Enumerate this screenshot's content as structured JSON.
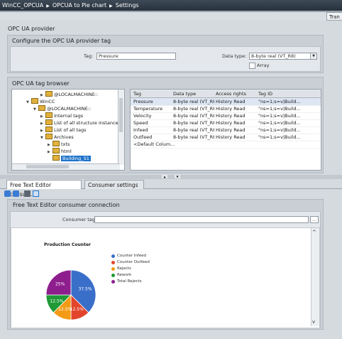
{
  "title_bar": {
    "crumbs": [
      "WinCC_OPCUA",
      "OPCUA to Pie chart",
      "Settings"
    ],
    "separator": "▶"
  },
  "top_tab": {
    "label": "Tran"
  },
  "opc_provider": {
    "section_title": "OPC UA provider",
    "panel_title": "Configure the OPC UA provider tag",
    "tag_label": "Tag:",
    "tag_value": "Pressure",
    "data_type_label": "Data type:",
    "data_type_value": "8-byte real (VT_R8)",
    "array_label": "Array"
  },
  "tag_browser": {
    "title": "OPC UA tag browser",
    "tree": [
      {
        "label": "@LOCALMACHINE::",
        "arrow": "▶"
      },
      {
        "label": "WinCC",
        "arrow": "▼"
      },
      {
        "label": "@LOCALMACHINE::",
        "arrow": "▼"
      },
      {
        "label": "Internal tags",
        "arrow": "▶"
      },
      {
        "label": "List of all structure instances",
        "arrow": "▶"
      },
      {
        "label": "List of all tags",
        "arrow": "▶"
      },
      {
        "label": "Archives",
        "arrow": "▼"
      },
      {
        "label": "txts",
        "arrow": "▶"
      },
      {
        "label": "html",
        "arrow": "▶"
      },
      {
        "label": "Building_S1",
        "arrow": ""
      }
    ],
    "columns": [
      "Tag",
      "Data type",
      "Access rights",
      "Tag ID"
    ],
    "rows": [
      [
        "Pressure",
        "8-byte real (VT_R8",
        "History Read",
        "\"ns=1;s=v|Build..."
      ],
      [
        "Temperature",
        "8-byte real (VT_R8",
        "History Read",
        "\"ns=1;s=v|Build..."
      ],
      [
        "Velocity",
        "8-byte real (VT_R8",
        "History Read",
        "\"ns=1;s=v|Build..."
      ],
      [
        "Speed",
        "8-byte real (VT_R8",
        "History Read",
        "\"ns=1;s=v|Build..."
      ],
      [
        "Infeed",
        "8-byte real (VT_R8",
        "History Read",
        "\"ns=1;s=v|Build..."
      ],
      [
        "Outfeed",
        "8-byte real (VT_R8",
        "History Read",
        "\"ns=1;s=v|Build..."
      ],
      [
        "<Default Colum...",
        "",
        "",
        ""
      ]
    ]
  },
  "bottom_tabs": [
    "Free Text Editor consum...",
    "Consumer settings"
  ],
  "consumer": {
    "panel_title": "Free Text Editor consumer connection",
    "consumer_tag_label": "Consumer tag:",
    "consumer_tag_value": "",
    "browse_label": "..."
  },
  "colors": {
    "accent": "#1f73c9",
    "titlebar": "#2f3a45"
  },
  "chart_data": {
    "type": "pie",
    "title": "Production Counter",
    "legend_position": "right",
    "slices": [
      {
        "name": "Counter Infeed",
        "value": 37.5,
        "label": "37.5%",
        "color": "#3a6fc9"
      },
      {
        "name": "Counter Outfeed",
        "value": 12.5,
        "label": "12.5%",
        "color": "#e2452b"
      },
      {
        "name": "Rejects",
        "value": 12.5,
        "label": "12.5%",
        "color": "#f39b16"
      },
      {
        "name": "Rework",
        "value": 12.5,
        "label": "12.5%",
        "color": "#1f9a37"
      },
      {
        "name": "Total Rejects",
        "value": 25,
        "label": "25%",
        "color": "#8e1e8e"
      }
    ]
  }
}
